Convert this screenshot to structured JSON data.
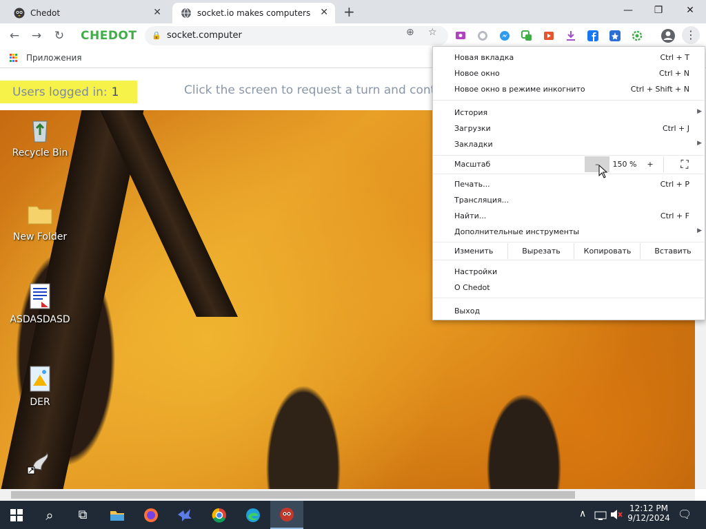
{
  "tabs": [
    {
      "title": "Chedot",
      "favicon": "chedot-logo-icon",
      "close": "✕"
    },
    {
      "title": "socket.io makes computers",
      "favicon": "globe-icon",
      "close": "✕"
    }
  ],
  "new_tab": "+",
  "window_controls": {
    "minimize": "—",
    "restore": "❐",
    "close": "✕"
  },
  "toolbar": {
    "back": "←",
    "forward": "→",
    "reload": "↻",
    "brand": "CHEDOT",
    "url": "socket.computer",
    "lock": "🔒",
    "zoom_icon": "⊕",
    "star": "☆",
    "extensions": [
      {
        "name": "cast-extension-icon",
        "color": "#b043c0"
      },
      {
        "name": "whatsapp-extension-icon",
        "color": "#b9bdc2"
      },
      {
        "name": "messenger-extension-icon",
        "color": "#2d9bf0"
      },
      {
        "name": "translate-extension-icon",
        "color": "#3fae49"
      },
      {
        "name": "video-extension-icon",
        "color": "#e6552d"
      },
      {
        "name": "download-extension-icon",
        "color": "#a14ed1"
      },
      {
        "name": "facebook-extension-icon",
        "color": "#1877f2"
      },
      {
        "name": "vk-extension-icon",
        "color": "#2a6fd6"
      },
      {
        "name": "settings-extension-icon",
        "color": "#3fae49"
      }
    ],
    "profile": "👤",
    "menu": "⋮"
  },
  "bookmarks": {
    "apps_label": "Приложения"
  },
  "page": {
    "users_label": "Users logged in:",
    "users_count": "1",
    "click_message": "Click the screen to request a turn and control"
  },
  "desktop_icons": [
    {
      "label": "Recycle Bin",
      "icon": "recycle-bin-icon"
    },
    {
      "label": "New Folder",
      "icon": "folder-icon"
    },
    {
      "label": "ASDASDASD",
      "icon": "document-icon"
    },
    {
      "label": "DER",
      "icon": "image-file-icon"
    },
    {
      "label": "",
      "icon": "shortcut-icon"
    }
  ],
  "menu": {
    "new_tab": {
      "label": "Новая вкладка",
      "shortcut": "Ctrl + T"
    },
    "new_window": {
      "label": "Новое окно",
      "shortcut": "Ctrl + N"
    },
    "incognito": {
      "label": "Новое окно в режиме инкогнито",
      "shortcut": "Ctrl + Shift + N"
    },
    "history": {
      "label": "История",
      "arrow": "▶"
    },
    "downloads": {
      "label": "Загрузки",
      "shortcut": "Ctrl + J"
    },
    "bookmarks": {
      "label": "Закладки",
      "arrow": "▶"
    },
    "zoom": {
      "label": "Масштаб",
      "minus": "–",
      "value": "150 %",
      "plus": "+",
      "fullscreen": "⛶"
    },
    "print": {
      "label": "Печать...",
      "shortcut": "Ctrl + P"
    },
    "cast": {
      "label": "Трансляция..."
    },
    "find": {
      "label": "Найти...",
      "shortcut": "Ctrl + F"
    },
    "more_tools": {
      "label": "Дополнительные инструменты",
      "arrow": "▶"
    },
    "edit": {
      "label": "Изменить",
      "cut": "Вырезать",
      "copy": "Копировать",
      "paste": "Вставить"
    },
    "settings": {
      "label": "Настройки"
    },
    "about": {
      "label": "О Chedot"
    },
    "exit": {
      "label": "Выход"
    }
  },
  "taskbar": {
    "start": "start-icon",
    "apps": [
      {
        "name": "search-icon",
        "glyph": "⌕"
      },
      {
        "name": "task-view-icon",
        "glyph": "⧉"
      },
      {
        "name": "file-explorer-icon",
        "color": "#f2c14e"
      },
      {
        "name": "firefox-icon",
        "color": "#ff7139"
      },
      {
        "name": "bird-app-icon",
        "color": "#5b7ce6"
      },
      {
        "name": "chrome-icon",
        "color": "#4caf50"
      },
      {
        "name": "edge-icon",
        "color": "#1fa0d8"
      },
      {
        "name": "chedot-taskbar-icon",
        "color": "#c0392b"
      }
    ],
    "tray": {
      "chevron": "∧",
      "time": "12:12 PM",
      "date": "9/12/2024",
      "notifications": "🗨"
    }
  }
}
